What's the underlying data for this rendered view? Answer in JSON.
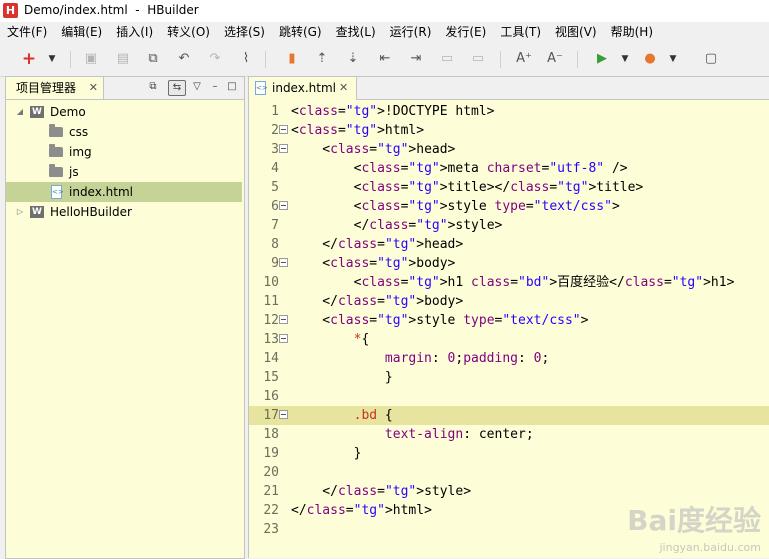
{
  "window": {
    "title": "Demo/index.html  -  HBuilder",
    "app_icon_letter": "H"
  },
  "menu": [
    "文件(F)",
    "编辑(E)",
    "插入(I)",
    "转义(O)",
    "选择(S)",
    "跳转(G)",
    "查找(L)",
    "运行(R)",
    "发行(E)",
    "工具(T)",
    "视图(V)",
    "帮助(H)"
  ],
  "toolbar": {
    "icons": [
      "new-icon",
      "dropdown-icon",
      "save-icon",
      "save-all-icon",
      "properties-icon",
      "undo-icon",
      "redo-icon",
      "format-icon",
      "bookmark-icon",
      "jump-up-icon",
      "jump-down-icon",
      "go-start-icon",
      "go-end-icon",
      "comment-icon",
      "uncomment-icon",
      "font-increase-icon",
      "font-decrease-icon",
      "run-icon",
      "dropdown-icon",
      "browser-icon",
      "dropdown-icon",
      "help-icon"
    ],
    "font_increase": "A⁺",
    "font_decrease": "A⁻"
  },
  "project_panel": {
    "tab_label": "项目管理器",
    "tree": [
      {
        "label": "Demo",
        "type": "project",
        "expanded": true,
        "level": 0
      },
      {
        "label": "css",
        "type": "folder",
        "level": 1
      },
      {
        "label": "img",
        "type": "folder",
        "level": 1
      },
      {
        "label": "js",
        "type": "folder",
        "level": 1
      },
      {
        "label": "index.html",
        "type": "file",
        "level": 1,
        "selected": true
      },
      {
        "label": "HelloHBuilder",
        "type": "project",
        "expanded": false,
        "level": 0
      }
    ]
  },
  "editor": {
    "tab_label": "index.html",
    "current_line": 17,
    "lines": [
      {
        "n": "1",
        "text": "<!DOCTYPE html>"
      },
      {
        "n": "2",
        "text": "<html>",
        "fold": true
      },
      {
        "n": "3",
        "text": "    <head>",
        "fold": true
      },
      {
        "n": "4",
        "text": "        <meta charset=\"utf-8\" />"
      },
      {
        "n": "5",
        "text": "        <title></title>"
      },
      {
        "n": "6",
        "text": "        <style type=\"text/css\">",
        "fold": true
      },
      {
        "n": "7",
        "text": "        </style>"
      },
      {
        "n": "8",
        "text": "    </head>"
      },
      {
        "n": "9",
        "text": "    <body>",
        "fold": true
      },
      {
        "n": "10",
        "text": "        <h1 class=\"bd\">百度经验</h1>"
      },
      {
        "n": "11",
        "text": "    </body>"
      },
      {
        "n": "12",
        "text": "    <style type=\"text/css\">",
        "fold": true
      },
      {
        "n": "13",
        "text": "        *{",
        "fold": true
      },
      {
        "n": "14",
        "text": "            margin: 0;padding: 0;"
      },
      {
        "n": "15",
        "text": "            }"
      },
      {
        "n": "16",
        "text": ""
      },
      {
        "n": "17",
        "text": "        .bd {",
        "fold": true
      },
      {
        "n": "18",
        "text": "            text-align: center;"
      },
      {
        "n": "19",
        "text": "        }"
      },
      {
        "n": "20",
        "text": ""
      },
      {
        "n": "21",
        "text": "    </style>"
      },
      {
        "n": "22",
        "text": "</html>"
      },
      {
        "n": "23",
        "text": ""
      }
    ]
  },
  "watermark": {
    "text": "Bai度经验",
    "sub": "jingyan.baidu.com"
  }
}
